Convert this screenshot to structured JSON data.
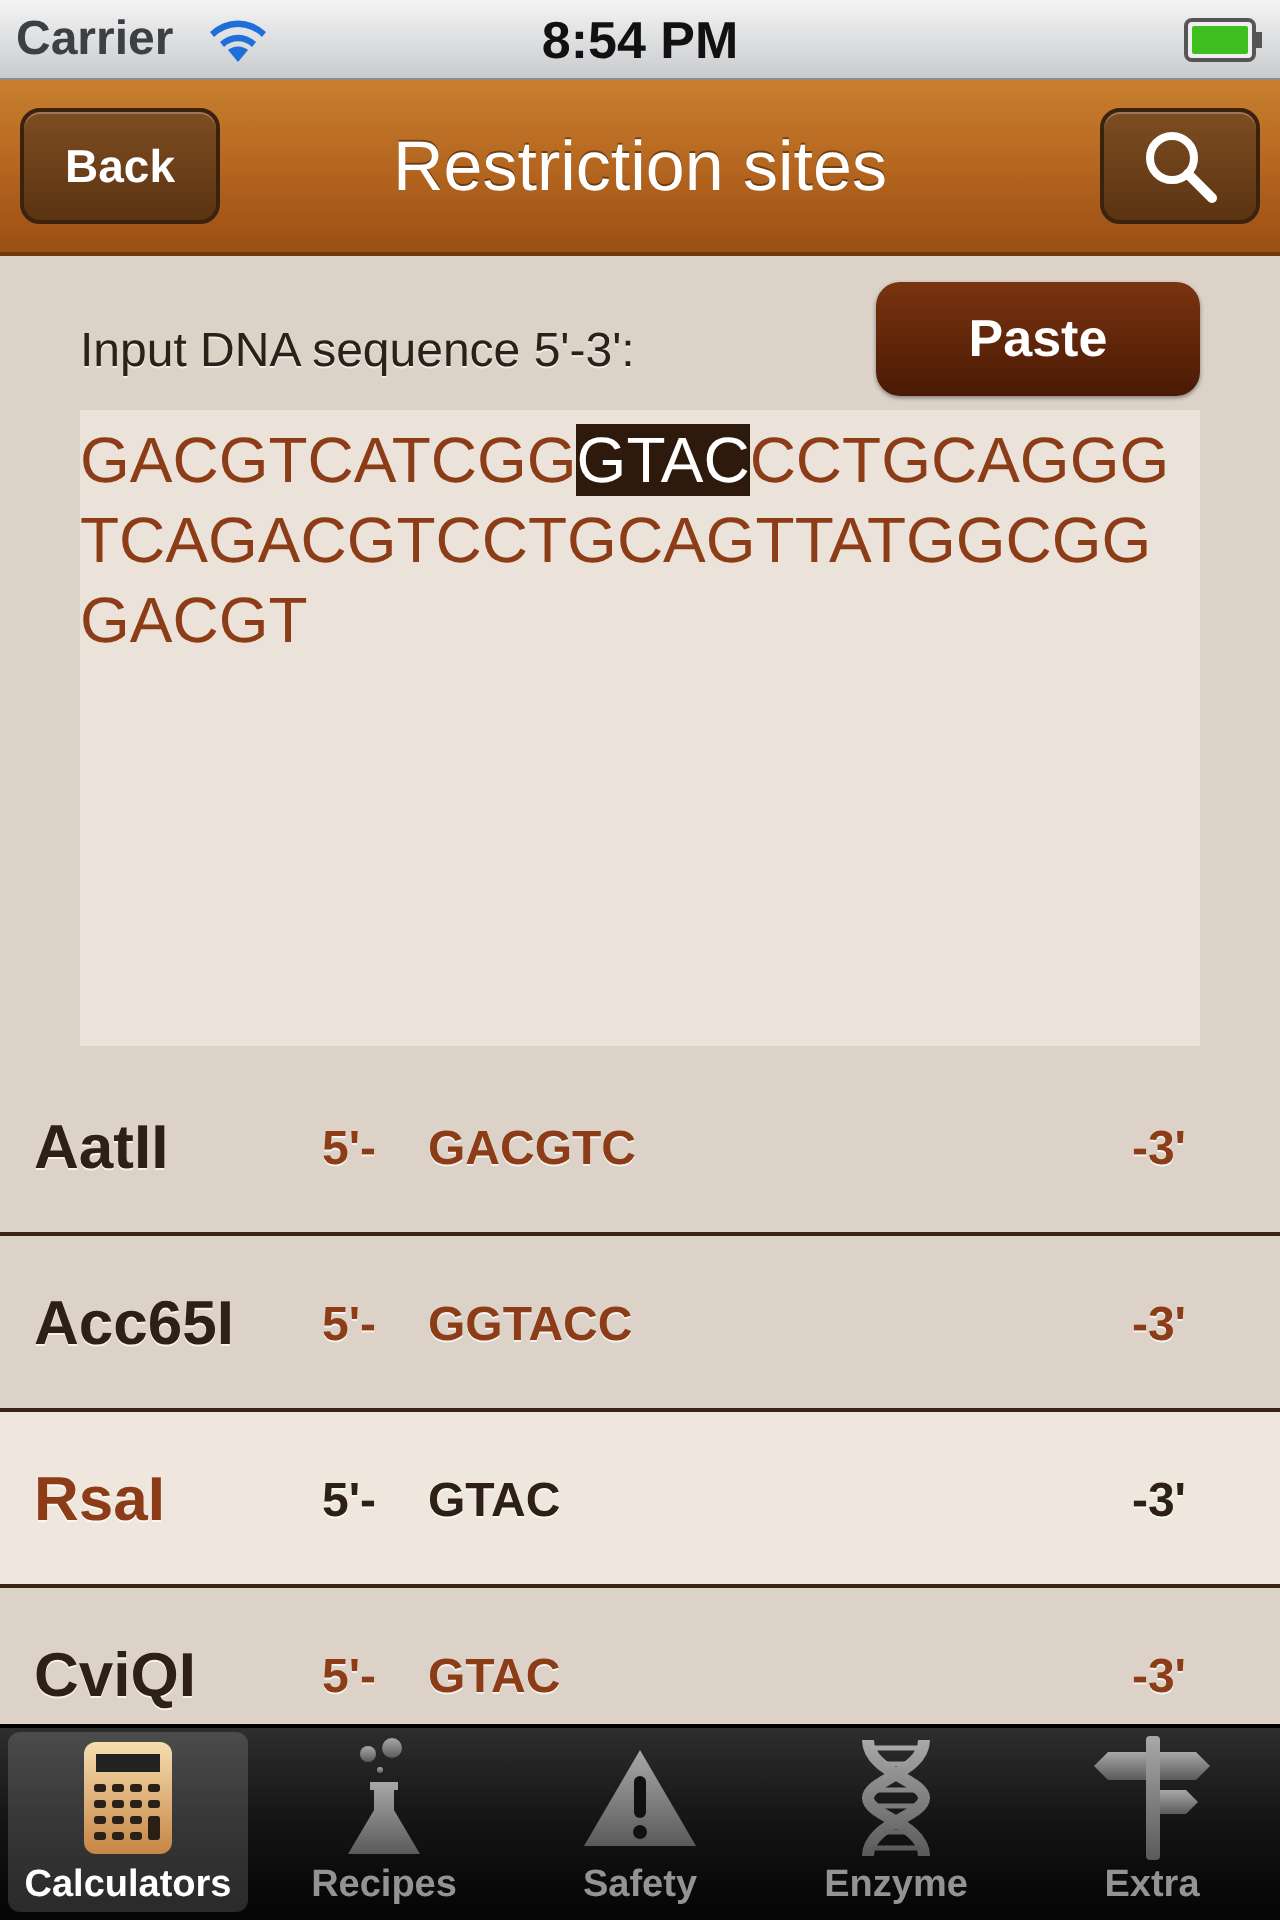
{
  "status_bar": {
    "carrier": "Carrier",
    "time": "8:54 PM"
  },
  "nav_bar": {
    "back": "Back",
    "title": "Restriction sites"
  },
  "input": {
    "label": "Input DNA sequence 5'-3':",
    "paste": "Paste",
    "sequence": [
      {
        "text": "GACGTCATCGG",
        "highlighted": false
      },
      {
        "text": "GTAC",
        "highlighted": true
      },
      {
        "text": "CCTGCAGGGTCAGACGTCCTGCAGTTATGGCGGGACGT",
        "highlighted": false
      }
    ]
  },
  "sites": [
    {
      "name": "AatII",
      "prefix": "5'-",
      "sequence": "GACGTC",
      "suffix": "-3'",
      "selected": false
    },
    {
      "name": "Acc65I",
      "prefix": "5'-",
      "sequence": "GGTACC",
      "suffix": "-3'",
      "selected": false
    },
    {
      "name": "RsaI",
      "prefix": "5'-",
      "sequence": "GTAC",
      "suffix": "-3'",
      "selected": true
    },
    {
      "name": "CviQI",
      "prefix": "5'-",
      "sequence": "GTAC",
      "suffix": "-3'",
      "selected": false
    }
  ],
  "tab_bar": [
    {
      "label": "Calculators",
      "selected": true
    },
    {
      "label": "Recipes",
      "selected": false
    },
    {
      "label": "Safety",
      "selected": false
    },
    {
      "label": "Enzyme",
      "selected": false
    },
    {
      "label": "Extra",
      "selected": false
    }
  ]
}
